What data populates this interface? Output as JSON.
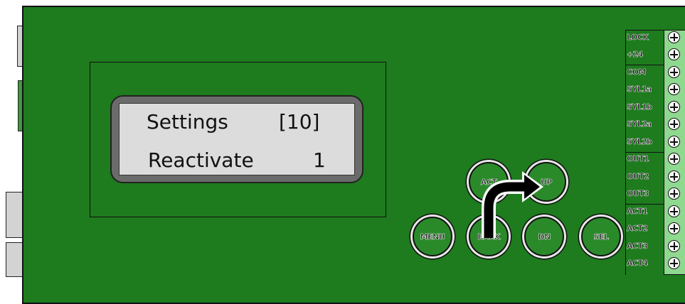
{
  "lcd": {
    "line1_label": "Settings",
    "line1_value": "[10]",
    "line2_label": "Reactivate",
    "line2_value": "1"
  },
  "buttons": {
    "act": "ACT",
    "up": "UP",
    "menu": "MENU",
    "back": "BACK",
    "dn": "DN",
    "sel": "SEL"
  },
  "terminals": [
    "LOCK",
    "+24",
    "COM",
    "SYL1a",
    "SYL1b",
    "SYL2a",
    "SYL2b",
    "OUT1",
    "OUT2",
    "OUT3",
    "ACT1",
    "ACT2",
    "ACT3",
    "ACT4"
  ],
  "colors": {
    "board": "#1e7b1e",
    "lcd_screen": "#dcdcdc",
    "lcd_bezel": "#6b6b6b",
    "terminal_block": "#8fd88f"
  },
  "icons": {
    "arrow": "curved-arrow-back-to-up"
  }
}
